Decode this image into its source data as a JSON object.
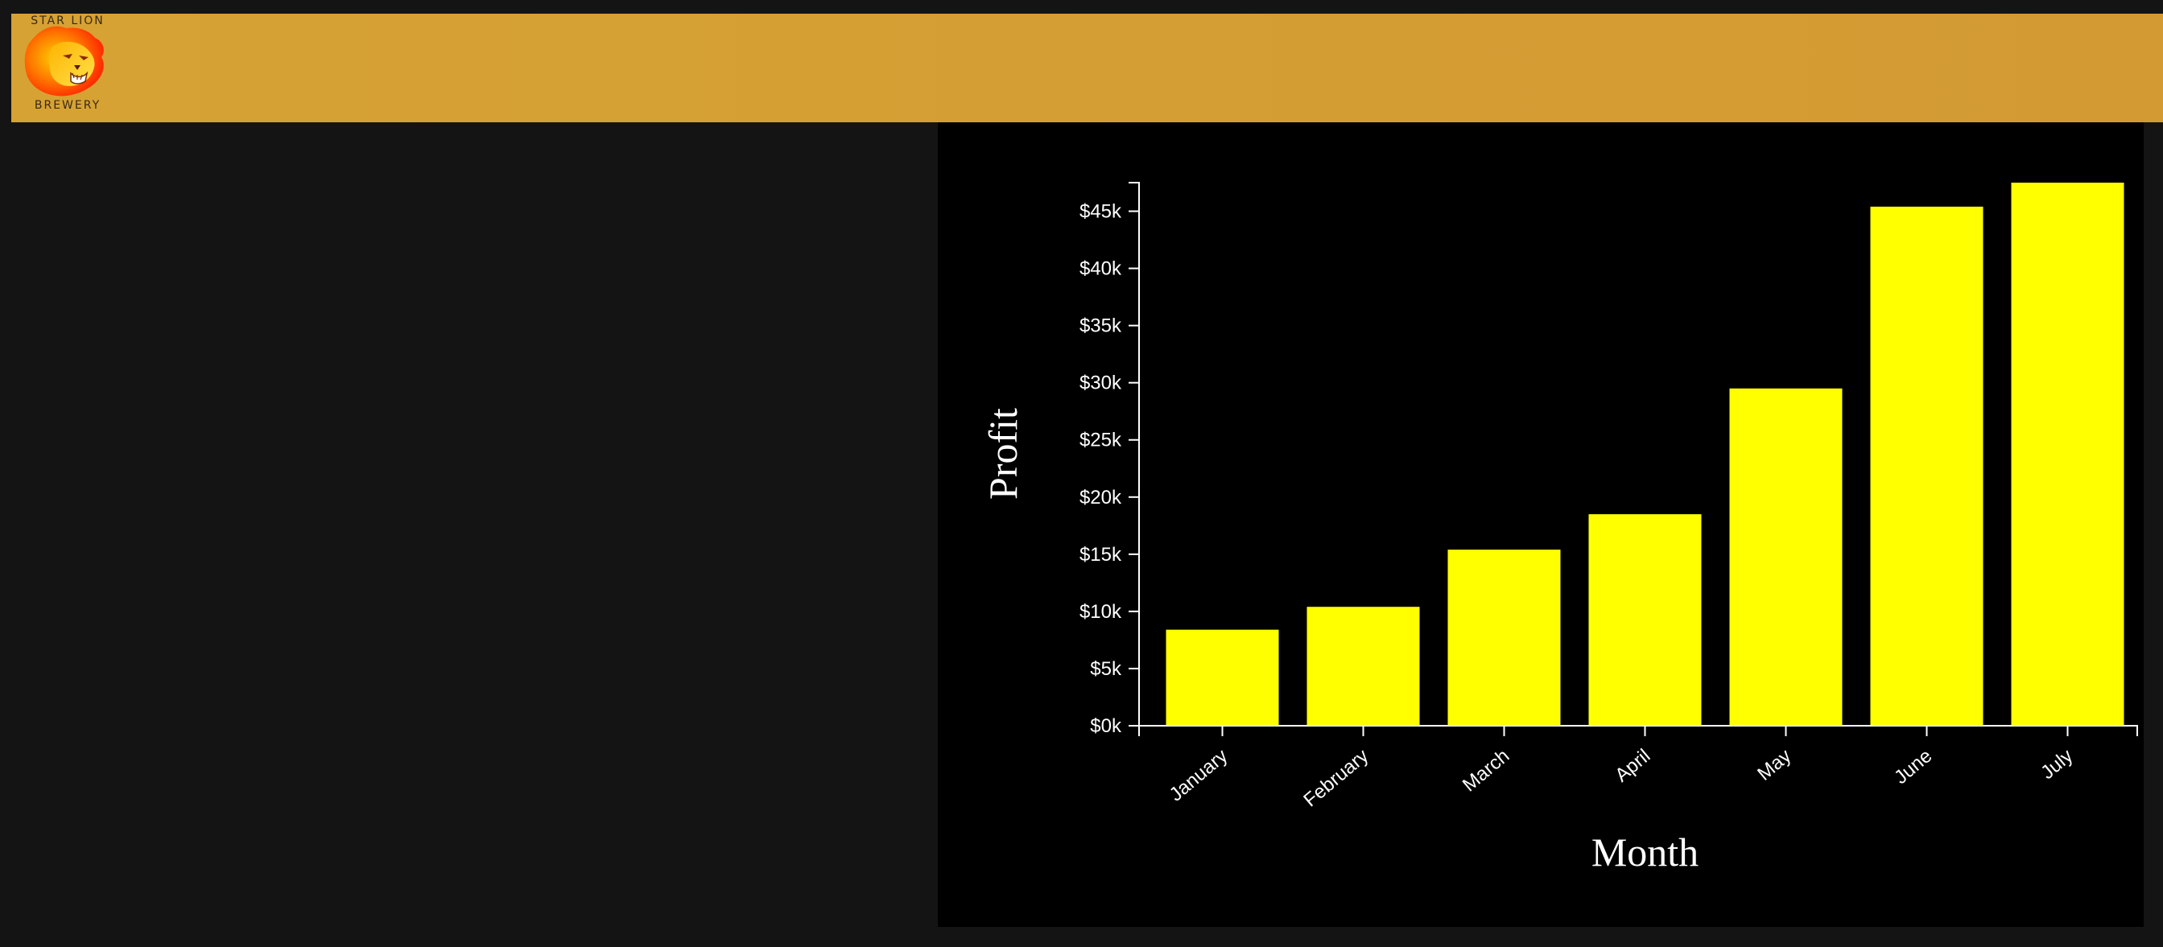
{
  "header": {
    "logo_top": "STAR LION",
    "logo_bottom": "BREWERY",
    "color": "#d49f34"
  },
  "logo": {
    "icon": "lion-head-icon",
    "colors": [
      "#ff2a00",
      "#ff7a00",
      "#ffd000"
    ]
  },
  "chart_data": {
    "type": "bar",
    "categories": [
      "January",
      "February",
      "March",
      "April",
      "May",
      "June",
      "July"
    ],
    "values": [
      8400,
      10400,
      15400,
      18500,
      29500,
      45400,
      47500
    ],
    "xlabel": "Month",
    "ylabel": "Profit",
    "ylim": [
      0,
      47500
    ],
    "yticks": [
      0,
      5000,
      10000,
      15000,
      20000,
      25000,
      30000,
      35000,
      40000,
      45000
    ],
    "ytick_labels": [
      "$0k",
      "$5k",
      "$10k",
      "$15k",
      "$20k",
      "$25k",
      "$30k",
      "$35k",
      "$40k",
      "$45k"
    ],
    "bar_color": "#ffff00",
    "axis_color": "#ffffff",
    "background": "#000000",
    "grid": false,
    "legend": "none"
  }
}
